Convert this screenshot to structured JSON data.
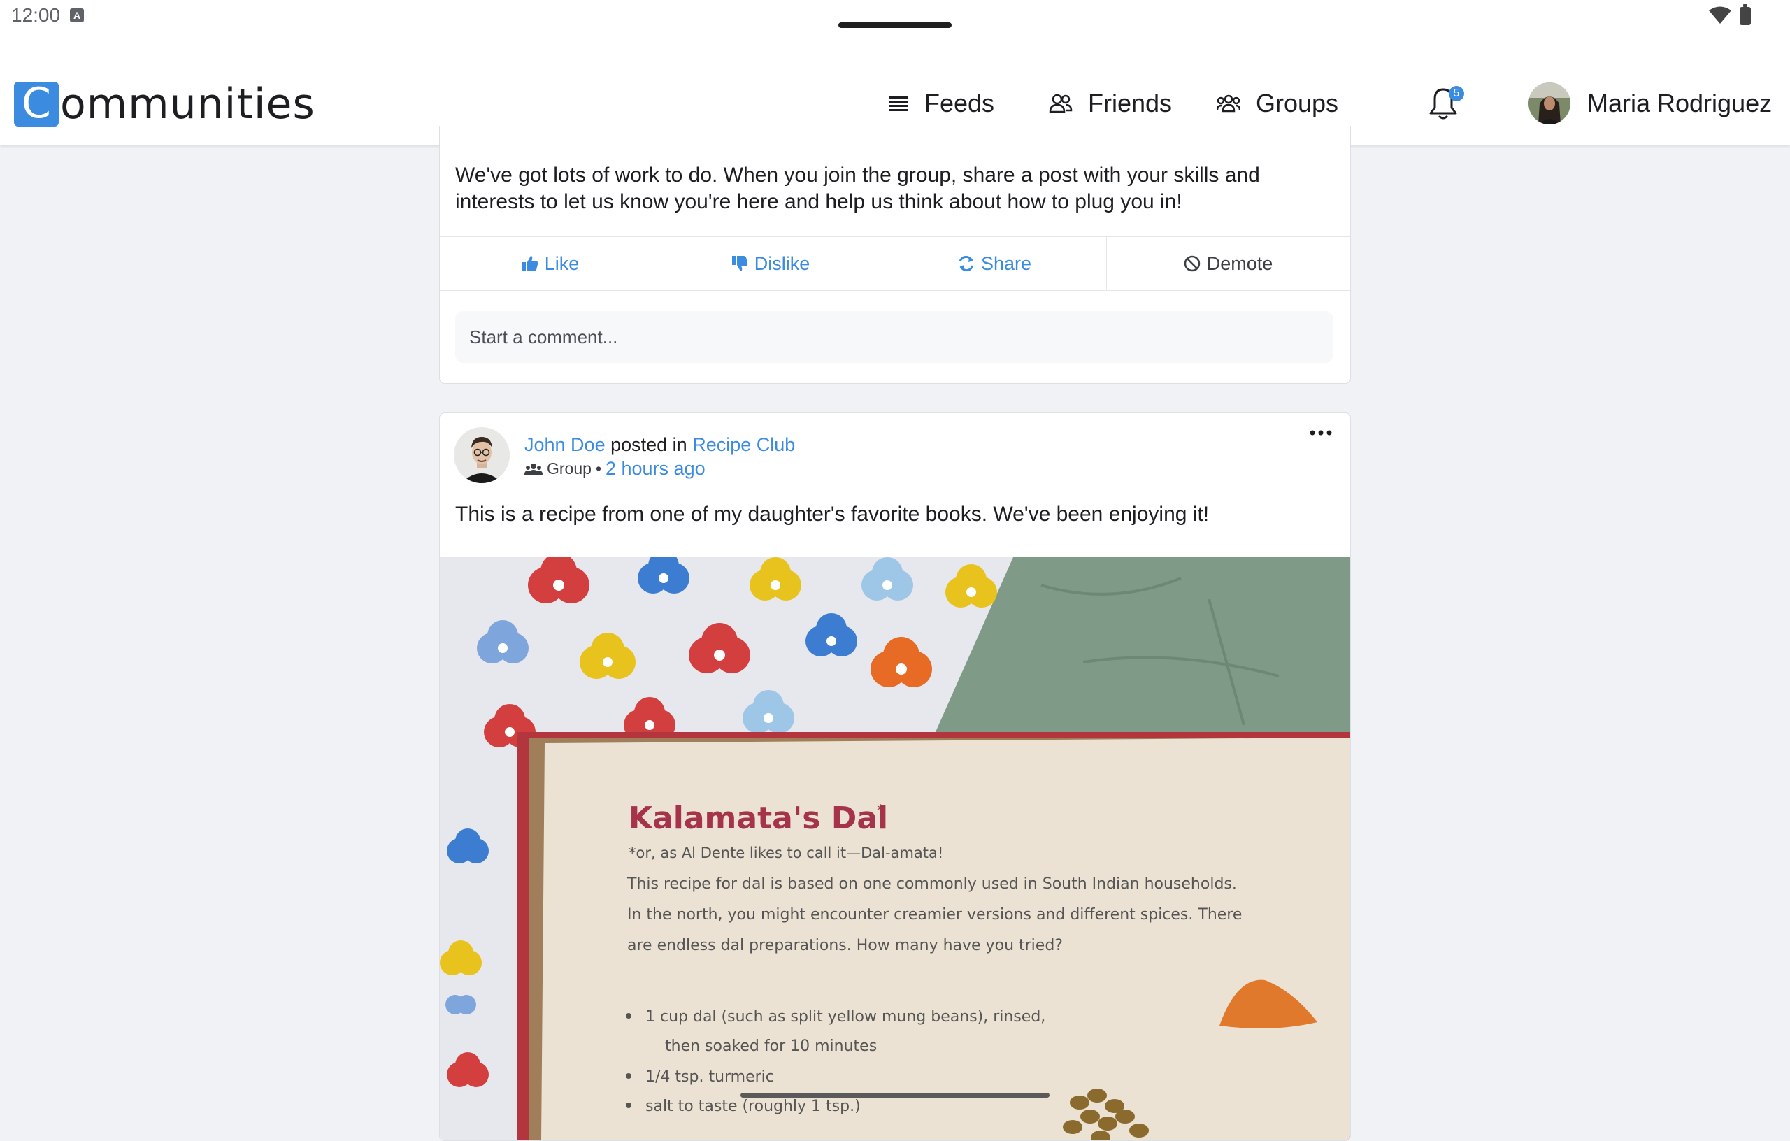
{
  "status_bar": {
    "time": "12:00",
    "notification_icon": "keyboard-a-icon",
    "wifi_icon": "wifi-icon",
    "battery_icon": "battery-icon"
  },
  "header": {
    "logo_letter": "C",
    "logo_rest": "ommunities",
    "nav": [
      {
        "label": "Feeds",
        "icon": "feeds-icon"
      },
      {
        "label": "Friends",
        "icon": "friends-icon"
      },
      {
        "label": "Groups",
        "icon": "groups-icon"
      }
    ],
    "notifications_count": "5",
    "user_name": "Maria Rodriguez",
    "accent_color": "#3b8be0"
  },
  "post1": {
    "text": "We've got lots of work to do. When you join the group, share a post with your skills and interests to let us know you're here and help us think about how to plug you in!",
    "actions": {
      "like": "Like",
      "dislike": "Dislike",
      "share": "Share",
      "demote": "Demote"
    },
    "comment_placeholder": "Start a comment..."
  },
  "post2": {
    "author": "John Doe",
    "posted_in": "posted in",
    "group_name": "Recipe Club",
    "audience": "Group",
    "separator": "•",
    "time": "2 hours ago",
    "text": "This is a recipe from one of my daughter's favorite books. We've been enjoying it!",
    "image": {
      "recipe_title": "Kalamata's Dal",
      "recipe_title_mark": "*",
      "subtitle": "*or, as Al Dente likes to call it—Dal-amata!",
      "intro": [
        "This recipe for dal is based on one commonly used in South Indian households.",
        "In the north, you might encounter creamier versions and different spices. There",
        "are endless dal preparations. How many have you tried?"
      ],
      "ingredients": [
        "1 cup dal (such as split yellow mung beans), rinsed,",
        "then soaked for 10 minutes",
        "1/4 tsp. turmeric",
        "salt to taste (roughly 1 tsp.)"
      ]
    }
  }
}
